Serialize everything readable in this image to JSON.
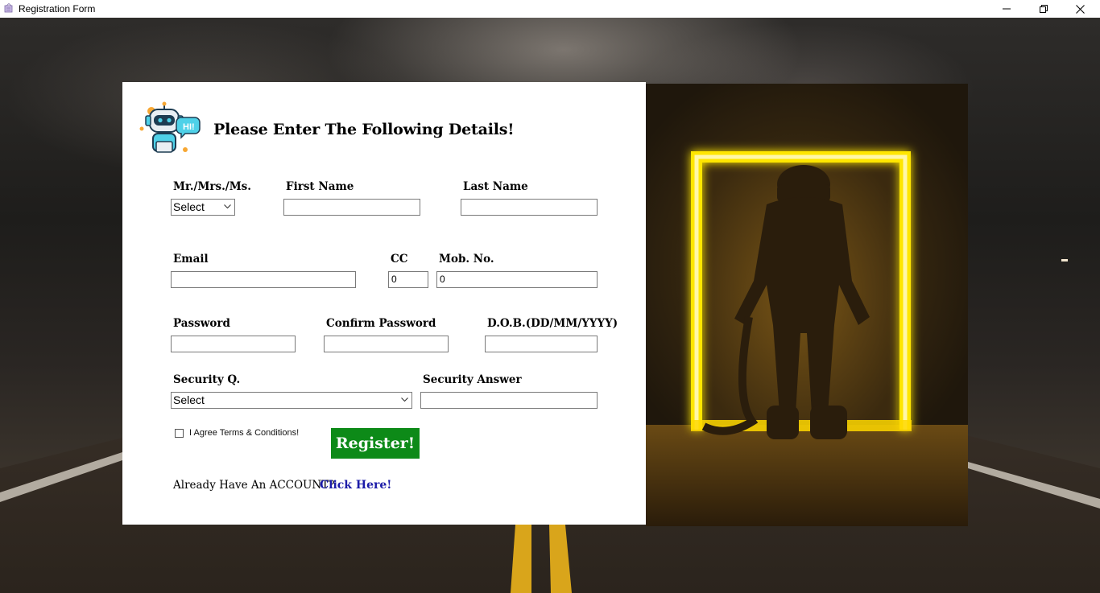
{
  "window": {
    "title": "Registration Form"
  },
  "form": {
    "heading": "Please Enter The Following Details!",
    "labels": {
      "title": "Mr./Mrs./Ms.",
      "first_name": "First Name",
      "last_name": "Last Name",
      "email": "Email",
      "cc": "CC",
      "mobile": "Mob. No.",
      "password": "Password",
      "confirm_password": "Confirm Password",
      "dob": "D.O.B.(DD/MM/YYYY)",
      "security_q": "Security Q.",
      "security_answer": "Security Answer"
    },
    "values": {
      "title_select": "Select",
      "first_name": "",
      "last_name": "",
      "email": "",
      "cc": "0",
      "mobile": "0",
      "password": "",
      "confirm_password": "",
      "dob": "",
      "security_q_select": "Select",
      "security_answer": ""
    },
    "terms_label": "I Agree Terms & Conditions!",
    "register_label": "Register!",
    "already_text": "Already Have An ACCOUNT?",
    "click_here": "Click Here!"
  },
  "robot_badge": "HI!",
  "colors": {
    "register_green": "#0d8a18",
    "link_blue": "#1a1aa8",
    "neon_yellow": "#ffe600"
  },
  "icons": [
    "app-icon",
    "minimize-icon",
    "maximize-icon",
    "close-icon",
    "robot-icon",
    "chevron-down-icon"
  ]
}
